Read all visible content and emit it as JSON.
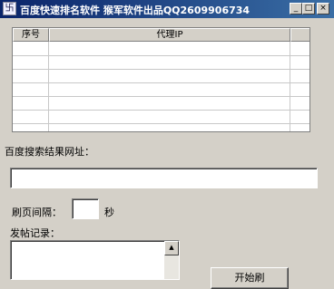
{
  "window": {
    "title": "百度快速排名软件 猴军软件出品QQ2609906734",
    "minimize_glyph": "_",
    "maximize_glyph": "□",
    "close_glyph": "×",
    "icon": "app-icon"
  },
  "proxy_table": {
    "columns": [
      "序号",
      "代理IP",
      ""
    ],
    "rows": []
  },
  "url_field": {
    "label": "百度搜索结果网址：",
    "value": ""
  },
  "interval": {
    "label": "刷页间隔：",
    "value": "",
    "unit": "秒"
  },
  "post_log": {
    "label": "发帖记录：",
    "value": ""
  },
  "start_button": {
    "label": "开始刷"
  }
}
